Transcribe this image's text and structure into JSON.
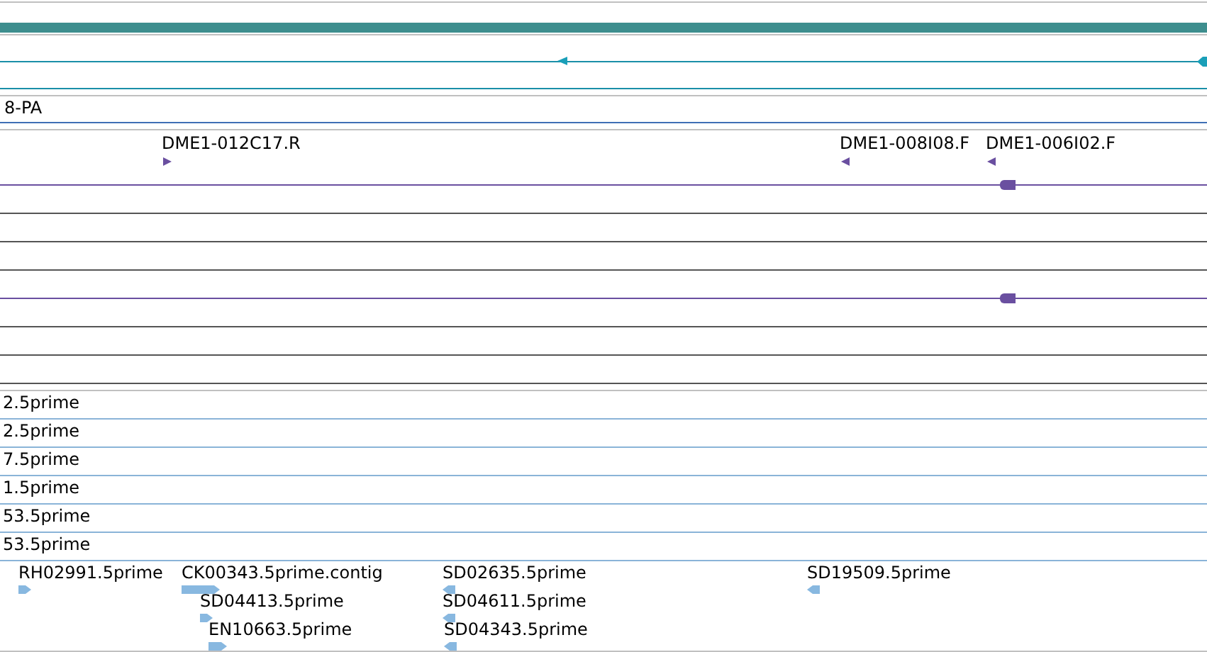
{
  "transcript_label": "8-PA",
  "clone_features": [
    {
      "label": "DME1-012C17.R",
      "reverse": false
    },
    {
      "label": "DME1-008I08.F",
      "reverse": true
    },
    {
      "label": "DME1-006I02.F",
      "reverse": true
    }
  ],
  "est_rows": [
    {
      "label": "2.5prime"
    },
    {
      "label": "2.5prime"
    },
    {
      "label": "7.5prime"
    },
    {
      "label": "1.5prime"
    },
    {
      "label": "53.5prime"
    },
    {
      "label": "53.5prime"
    }
  ],
  "est_features": [
    {
      "label": "RH02991.5prime",
      "reverse": false
    },
    {
      "label": "CK00343.5prime.contig",
      "reverse": false
    },
    {
      "label": "SD04413.5prime",
      "reverse": false
    },
    {
      "label": "EN10663.5prime",
      "reverse": false
    },
    {
      "label": "SD02635.5prime",
      "reverse": true
    },
    {
      "label": "SD04611.5prime",
      "reverse": true
    },
    {
      "label": "SD04343.5prime",
      "reverse": true
    },
    {
      "label": "SD19509.5prime",
      "reverse": true
    }
  ]
}
